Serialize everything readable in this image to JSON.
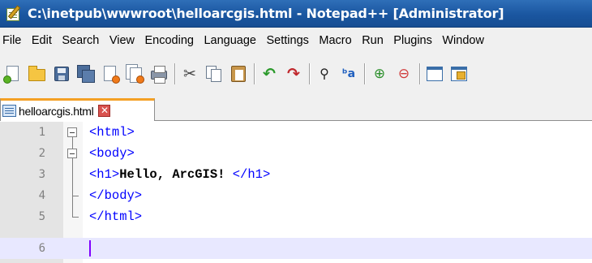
{
  "window": {
    "title": "C:\\inetpub\\wwwroot\\helloarcgis.html - Notepad++ [Administrator]"
  },
  "menu": {
    "items": [
      "File",
      "Edit",
      "Search",
      "View",
      "Encoding",
      "Language",
      "Settings",
      "Macro",
      "Run",
      "Plugins",
      "Window"
    ]
  },
  "toolbar": {
    "buttons": [
      "new-file",
      "open-file",
      "save",
      "save-all",
      "close",
      "close-all",
      "print",
      "cut",
      "copy",
      "paste",
      "undo",
      "redo",
      "find",
      "replace",
      "zoom-in",
      "zoom-out",
      "sync-vertical",
      "sync-horizontal"
    ]
  },
  "tabs": [
    {
      "label": "helloarcgis.html",
      "close_glyph": "✕"
    }
  ],
  "editor": {
    "lines": [
      {
        "num": "1",
        "parts": [
          {
            "t": "<html>",
            "k": "tag"
          }
        ]
      },
      {
        "num": "2",
        "parts": [
          {
            "t": "<body>",
            "k": "tag"
          }
        ]
      },
      {
        "num": "3",
        "parts": [
          {
            "t": "<h1>",
            "k": "tag"
          },
          {
            "t": "Hello, ArcGIS! ",
            "k": "txt"
          },
          {
            "t": "</h1>",
            "k": "tag"
          }
        ]
      },
      {
        "num": "4",
        "parts": [
          {
            "t": "</body>",
            "k": "tag"
          }
        ]
      },
      {
        "num": "5",
        "parts": [
          {
            "t": "</html>",
            "k": "tag"
          }
        ]
      },
      {
        "num": "6",
        "parts": []
      }
    ],
    "current_line": "6"
  },
  "colors": {
    "titlebar": "#1a56a0",
    "tab_accent": "#f4a024",
    "tag": "#0000ff",
    "current_line": "#e8e8ff",
    "caret": "#8000ff"
  }
}
